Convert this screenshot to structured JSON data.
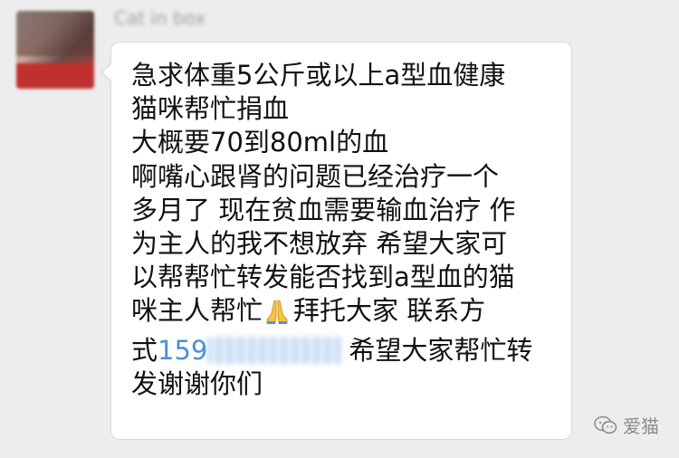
{
  "chat": {
    "sender_name": "Cat in box",
    "message_lines": [
      "急求体重5公斤或以上a型血健康",
      "猫咪帮忙捐血",
      "大概要70到80ml的血",
      "啊嘴心跟肾的问题已经治疗一个",
      "多月了 现在贫血需要输血治疗 作",
      "为主人的我不想放弃 希望大家可",
      "以帮帮忙转发能否找到a型血的猫"
    ],
    "line8_before_icon": "咪主人帮忙",
    "line8_after_icon": "拜托大家 联系方",
    "line9_prefix": "式",
    "phone_visible_prefix": "159",
    "line9_after_phone": "希望大家帮忙转",
    "line10": "发谢谢你们",
    "emoji_icon": "folded-hands-icon"
  },
  "watermark": {
    "text": "爱猫",
    "icon": "wechat-icon"
  },
  "colors": {
    "background": "#ededed",
    "bubble": "#ffffff",
    "text": "#111111",
    "phone_link": "#4a90d9"
  }
}
